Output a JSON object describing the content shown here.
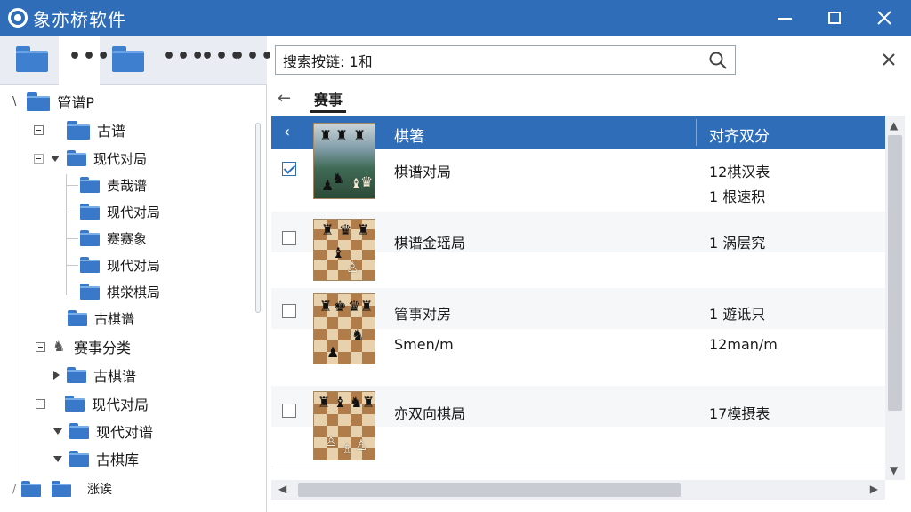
{
  "app": {
    "title": "象亦桥软件"
  },
  "toolbar": {
    "dots": [
      "•••",
      "•••",
      "•••",
      "•••"
    ]
  },
  "tree": {
    "items": [
      {
        "label": "管谱P"
      },
      {
        "label": "古谱"
      },
      {
        "label": "现代对局"
      },
      {
        "label": "责哉谱"
      },
      {
        "label": "现代对局"
      },
      {
        "label": "赛赛象"
      },
      {
        "label": "现代对局"
      },
      {
        "label": "棋泶棋局"
      },
      {
        "label": "古棋谱"
      },
      {
        "label": "赛事分类"
      },
      {
        "label": "古棋谱"
      },
      {
        "label": "现代对局"
      },
      {
        "label": "现代对谱"
      },
      {
        "label": "古棋库"
      },
      {
        "label": "涨诶"
      }
    ]
  },
  "search": {
    "value": "搜索按链: 1和"
  },
  "tabs": {
    "active": "赛事"
  },
  "grid": {
    "headers": {
      "col1": "棋箸",
      "col2": "对齐双分"
    },
    "rows": [
      {
        "checked": true,
        "title": "棋谱对局",
        "sub": "",
        "meta1": "12棋汉表",
        "meta2": "1  根速积"
      },
      {
        "checked": false,
        "title": "棋谱金瑶局",
        "sub": "",
        "meta1": "1 涡层究",
        "meta2": ""
      },
      {
        "checked": false,
        "title": "管事对房",
        "sub": "Smen/m",
        "meta1": "1 遊诋只",
        "meta2": "12man/m"
      },
      {
        "checked": false,
        "title": "亦双向棋局",
        "sub": "",
        "meta1": "17模摂表",
        "meta2": ""
      }
    ]
  },
  "colors": {
    "accent": "#2f6db8",
    "folder": "#3a78c9"
  }
}
